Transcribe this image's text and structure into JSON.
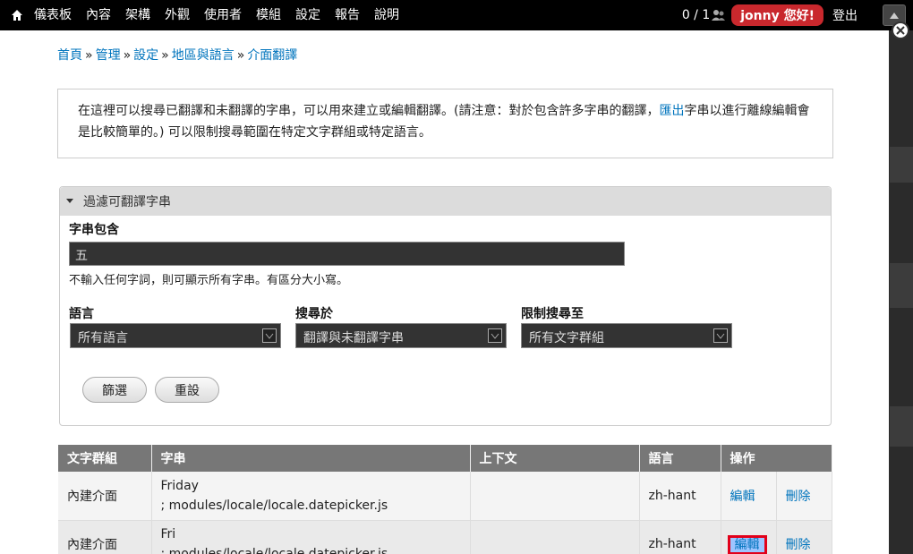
{
  "toolbar": {
    "menu": [
      "儀表板",
      "內容",
      "架構",
      "外觀",
      "使用者",
      "模組",
      "設定",
      "報告",
      "說明"
    ],
    "counter": "0 / 1",
    "user_greeting": "jonny 您好!",
    "logout": "登出"
  },
  "breadcrumb": [
    "首頁",
    "管理",
    "設定",
    "地區與語言",
    "介面翻譯"
  ],
  "help": {
    "text_before": "在這裡可以搜尋已翻譯和未翻譯的字串，可以用來建立或編輯翻譯。(請注意：對於包含許多字串的翻譯，",
    "link": "匯出",
    "text_after": "字串以進行離線編輯會是比較簡單的。) 可以限制搜尋範圍在特定文字群組或特定語言。"
  },
  "filter": {
    "legend": "過濾可翻譯字串",
    "string_label": "字串包含",
    "string_value": "五",
    "string_desc": "不輸入任何字詞，則可顯示所有字串。有區分大小寫。",
    "language_label": "語言",
    "language_value": "所有語言",
    "search_in_label": "搜尋於",
    "search_in_value": "翻譯與未翻譯字串",
    "group_label": "限制搜尋至",
    "group_value": "所有文字群組",
    "filter_button": "篩選",
    "reset_button": "重設"
  },
  "table": {
    "headers": [
      "文字群組",
      "字串",
      "上下文",
      "語言",
      "操作"
    ],
    "rows": [
      {
        "group": "內建介面",
        "string": "Friday",
        "source": "; modules/locale/locale.datepicker.js",
        "context": "",
        "language": "zh-hant",
        "edit": "編輯",
        "delete": "刪除"
      },
      {
        "group": "內建介面",
        "string": "Fri",
        "source": "; modules/locale/locale.datepicker.js",
        "context": "",
        "language": "zh-hant",
        "edit": "編輯",
        "delete": "刪除"
      }
    ]
  },
  "colors": {
    "link": "#0074bd",
    "toolbar_bg": "#000000",
    "user_pill": "#c9282d",
    "table_header": "#777777",
    "highlight": "#e2001a"
  }
}
